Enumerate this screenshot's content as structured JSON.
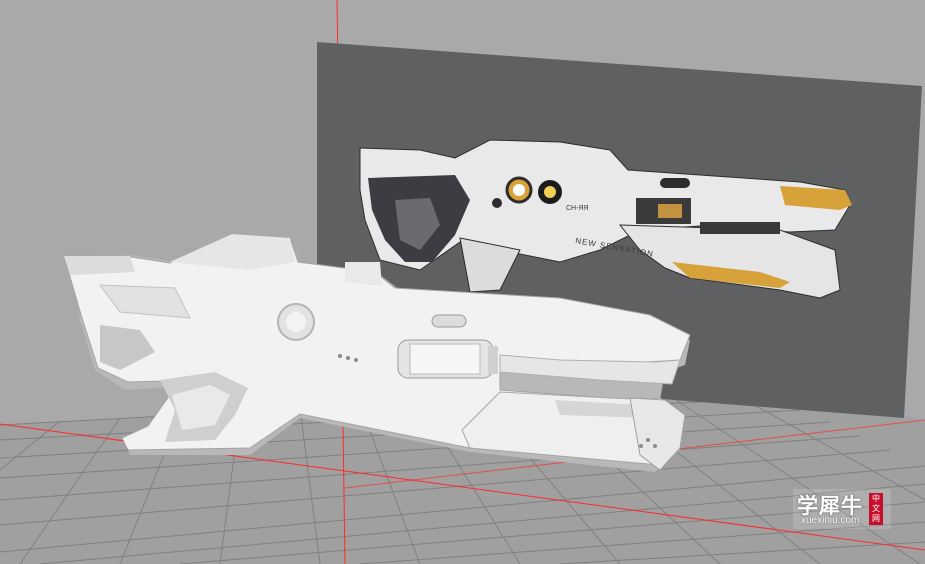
{
  "viewport": {
    "background_color": "#a9a9a9",
    "reference_panel_color": "#5f6062",
    "grid_color": "#7f7f7f",
    "axis_color": "#ff2a2a"
  },
  "model": {
    "body_color": "#f2f2f2",
    "shadow_color": "#b8b8b8",
    "dark_part_color": "#3c3d42",
    "accent_color": "#d7a23a"
  },
  "reference_image": {
    "decal_text": "NEW SENSATION",
    "small_label": "CH-ЯЯ"
  },
  "watermark": {
    "main_text": "学犀牛",
    "sub_text": "xuexiniu.com",
    "badge_text": "中文网"
  }
}
